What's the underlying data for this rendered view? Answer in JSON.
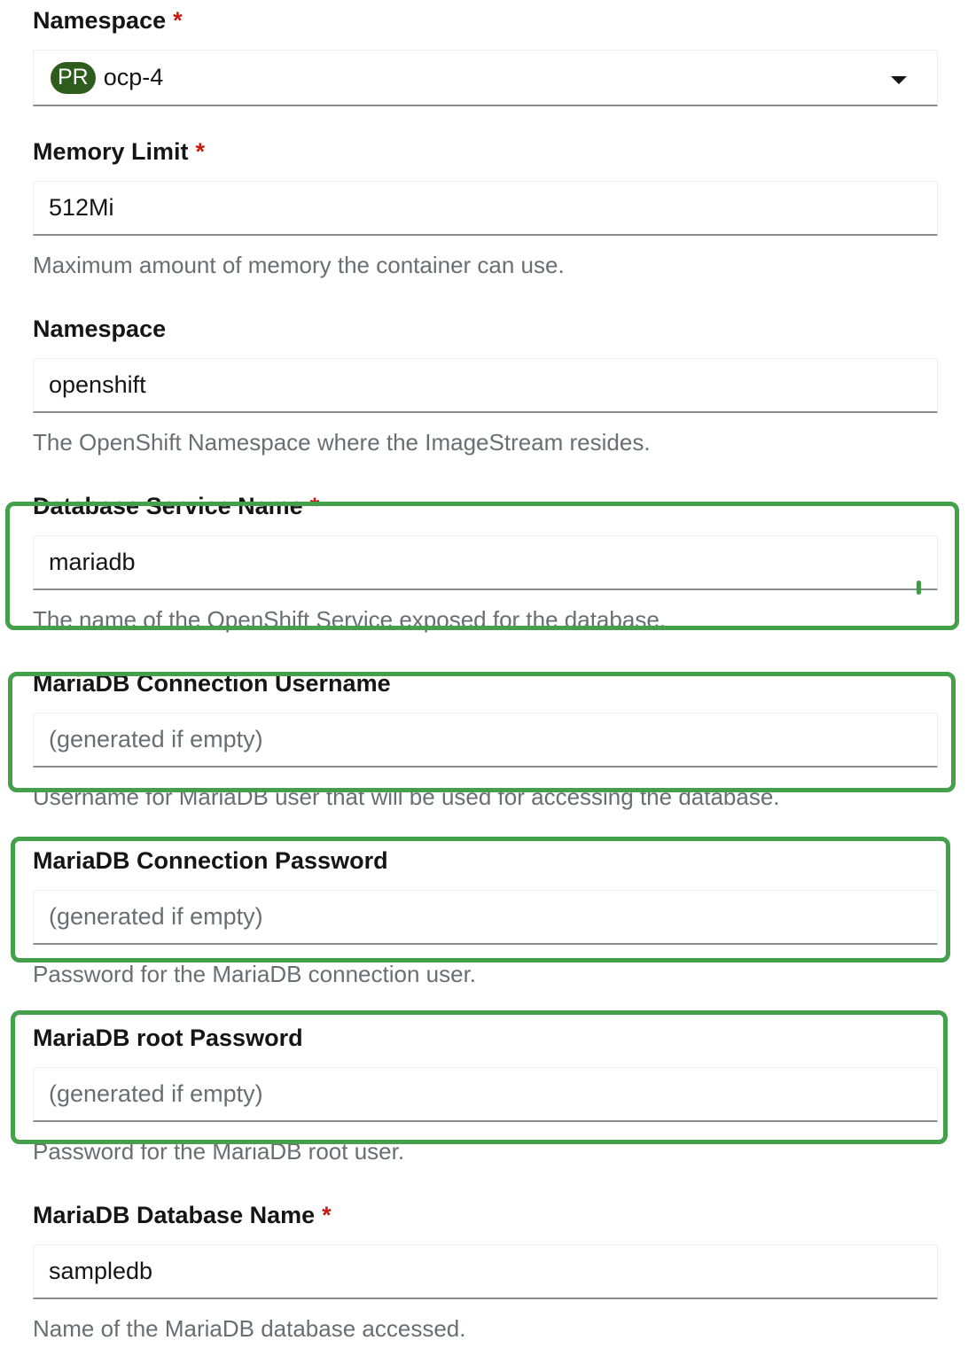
{
  "fields": [
    {
      "label": "Namespace",
      "required": "*",
      "badge": "PR",
      "value": "ocp-4"
    },
    {
      "label": "Memory Limit",
      "required": "*",
      "value": "512Mi",
      "helper": "Maximum amount of memory the container can use."
    },
    {
      "label": "Namespace",
      "value": "openshift",
      "helper": "The OpenShift Namespace where the ImageStream resides."
    },
    {
      "label": "Database Service Name",
      "required": "*",
      "value": "mariadb",
      "helper": "The name of the OpenShift Service exposed for the database."
    },
    {
      "label": "MariaDB Connection Username",
      "placeholder": "(generated if empty)",
      "helper": "Username for MariaDB user that will be used for accessing the database."
    },
    {
      "label": "MariaDB Connection Password",
      "placeholder": "(generated if empty)",
      "helper": "Password for the MariaDB connection user."
    },
    {
      "label": "MariaDB root Password",
      "placeholder": "(generated if empty)",
      "helper": "Password for the MariaDB root user."
    },
    {
      "label": "MariaDB Database Name",
      "required": "*",
      "value": "sampledb",
      "helper": "Name of the MariaDB database accessed."
    }
  ],
  "colors": {
    "highlight": "#44a04a",
    "badge": "#2e5c1d",
    "required": "#c9190b",
    "helper_text": "#6a6e73"
  },
  "icons": {
    "dropdown": "caret-down-icon"
  }
}
